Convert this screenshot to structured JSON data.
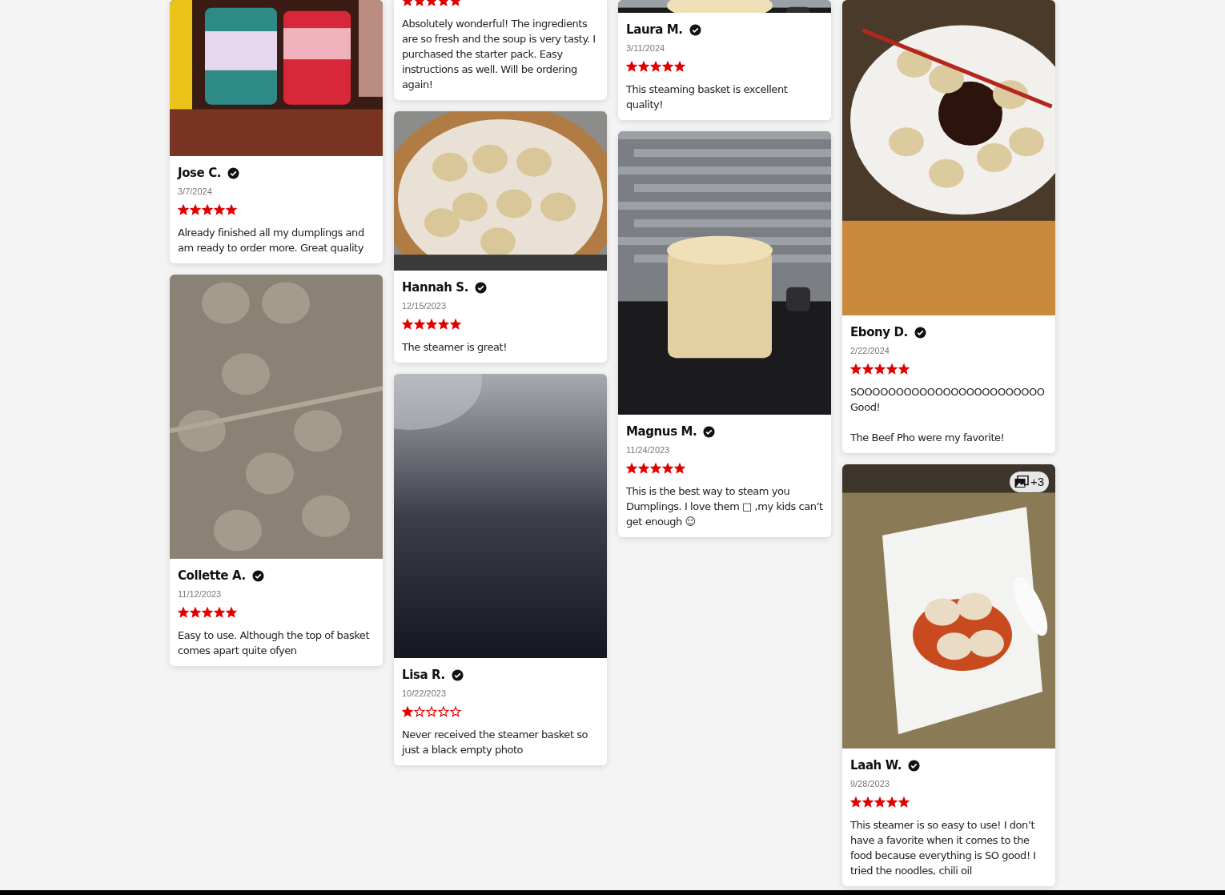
{
  "columns": [
    {
      "reviews": [
        {
          "name": "Jose C.",
          "date": "3/7/2024",
          "stars": 5,
          "text": "Already finished all my dumplings and am ready to order more. Great quality"
        },
        {
          "name": "Collette A.",
          "date": "11/12/2023",
          "stars": 5,
          "text": "Easy to use. Although the top of basket comes apart quite ofyen"
        }
      ]
    },
    {
      "reviews": [
        {
          "stars": 5,
          "text": "Absolutely wonderful! The ingredients are so fresh and the soup is very tasty. I purchased the starter pack. Easy instructions as well. Will be ordering again!"
        },
        {
          "name": "Hannah S.",
          "date": "12/15/2023",
          "stars": 5,
          "text": "The steamer is great!"
        },
        {
          "name": "Lisa R.",
          "date": "10/22/2023",
          "stars": 1,
          "text": "Never received the steamer basket so just a black empty photo"
        }
      ]
    },
    {
      "reviews": [
        {
          "name": "Laura M.",
          "date": "3/11/2024",
          "stars": 5,
          "text": "This steaming basket is excellent quality!"
        },
        {
          "name": "Magnus M.",
          "date": "11/24/2023",
          "stars": 5,
          "text": "This is the  best way to steam you Dumplings. I love them □ ,my kids can’t get enough ☺"
        }
      ]
    },
    {
      "reviews": [
        {
          "name": "Ebony D.",
          "date": "2/22/2024",
          "stars": 5,
          "text": "SOOOOOOOOOOOOOOOOOOOOOOOO Good!\n\nThe Beef Pho were my favorite!"
        },
        {
          "image": {
            "kind": "picture",
            "photo_count": "+3"
          },
          "name": "Laah W.",
          "date": "9/28/2023",
          "stars": 5,
          "text": "This steamer is so easy to use! I don’t have a favorite when it comes to the food because everything is SO good! I tried the noodles, chili oil"
        }
      ]
    }
  ]
}
